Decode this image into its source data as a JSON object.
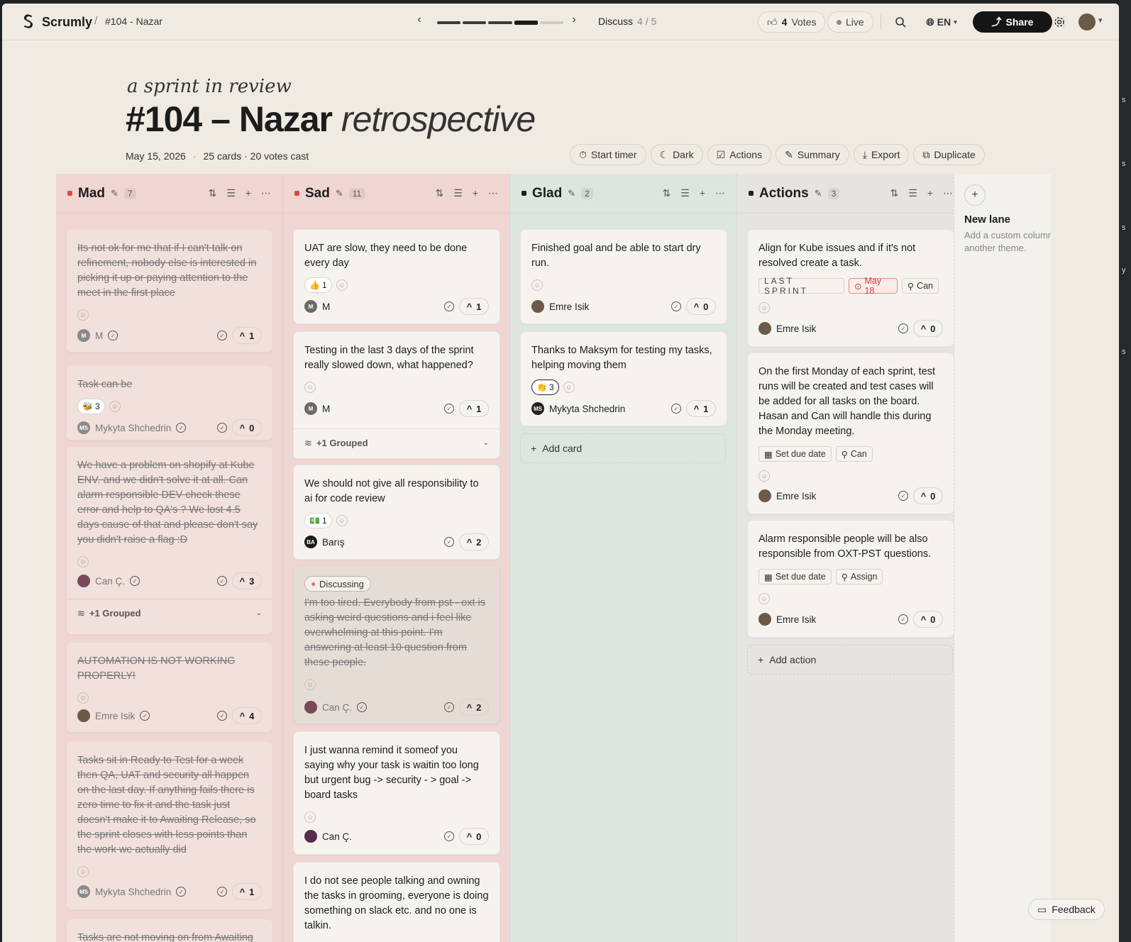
{
  "app": {
    "brand": "Scrumly",
    "crumb": "#104 - Nazar"
  },
  "stepper": {
    "phase": "Discuss",
    "count": "4 / 5"
  },
  "topbar": {
    "votes_num": "4",
    "votes_label": "Votes",
    "live": "Live",
    "lang": "EN",
    "share": "Share"
  },
  "hero": {
    "subtitle": "a sprint in review",
    "title_bold": "#104 – Nazar",
    "title_italic": "retrospective",
    "date": "May 15, 2026",
    "stats": "25 cards · 20 votes cast"
  },
  "toolbar": [
    "Start timer",
    "Dark",
    "Actions",
    "Summary",
    "Export",
    "Duplicate"
  ],
  "columns": {
    "mad": {
      "title": "Mad",
      "count": "7",
      "color": "#d64a43"
    },
    "sad": {
      "title": "Sad",
      "count": "11",
      "color": "#d64a43"
    },
    "glad": {
      "title": "Glad",
      "count": "2",
      "color": "#1e1e1e"
    },
    "actions": {
      "title": "Actions",
      "count": "3",
      "color": "#1e1e1e"
    }
  },
  "mad_cards": [
    {
      "text": "Its not ok for me that if I can't talk on refinement, nobody else is interested in picking it up or paying attention to the meet in the first place",
      "author": "M",
      "initials": "M",
      "votes": "1"
    },
    {
      "text": "Task can be",
      "emoji": "🐝",
      "emoji_count": "3",
      "author": "Mykyta Shchedrin",
      "initials": "MS",
      "votes": "0"
    },
    {
      "text": "We have a problem on shopify at Kube ENV. and we didn't solve it at all. Can alarm responsible DEV check these error and help to QA's ? We lost 4.5 days cause of that and please don't say you didn't raise a flag :D",
      "author": "Can Ç.",
      "initials": "",
      "votes": "3",
      "grouped": "+1 Grouped"
    },
    {
      "text": "AUTOMATION IS NOT WORKING PROPERLY!",
      "author": "Emre Isik",
      "initials": "",
      "votes": "4"
    },
    {
      "text": "Tasks sit in Ready to Test for a week then QA, UAT and security all happen on the last day. If anything fails there is zero time to fix it and the task just doesn't make it to Awaiting Release, so the sprint closes with less points than the work we actually did",
      "author": "Mykyta Shchedrin",
      "initials": "MS",
      "votes": "1"
    },
    {
      "text": "Tasks are not moving on from Awaiting"
    }
  ],
  "sad_cards": [
    {
      "text": "UAT are slow, they need to be done every day",
      "emoji": "👍",
      "emoji_count": "1",
      "author": "M",
      "initials": "M",
      "votes": "1"
    },
    {
      "text": "Testing in the last 3 days of the sprint really slowed down, what happened?",
      "author": "M",
      "initials": "M",
      "votes": "1",
      "grouped": "+1 Grouped"
    },
    {
      "text": "We should not give all responsibility to ai for code review",
      "emoji": "💵",
      "emoji_count": "1",
      "author": "Barış",
      "initials": "BA",
      "votes": "2"
    },
    {
      "badge": "Discussing",
      "text": "I'm too tired. Everybody from pst - oxt is asking weird questions and i feel like overwhelming at this point. I'm answering at least 10 question from these people.",
      "author": "Can Ç.",
      "initials": "",
      "votes": "2"
    },
    {
      "text": "I just wanna remind it someof you saying why your task is waitin too long but urgent bug -> security - > goal -> board tasks",
      "author": "Can Ç.",
      "initials": "",
      "votes": "0"
    },
    {
      "text": "I do not see people talking and owning the tasks in grooming, everyone is doing something on slack etc. and no one is talkin."
    }
  ],
  "glad_cards": [
    {
      "text": "Finished goal and be able to start dry run.",
      "author": "Emre Isik",
      "initials": "",
      "votes": "0"
    },
    {
      "text": "Thanks to Maksym for testing my tasks, helping moving them",
      "emoji": "👏",
      "emoji_count": "3",
      "author": "Mykyta Shchedrin",
      "initials": "MS",
      "votes": "1"
    }
  ],
  "glad_add": "Add card",
  "action_cards": [
    {
      "text": "Align for Kube issues and if it's not resolved create a task.",
      "tag_sprint": "LAST SPRINT",
      "tag_due": "May 18",
      "tag_assignee": "Can",
      "author": "Emre Isik",
      "votes": "0"
    },
    {
      "text": "On the first Monday of each sprint, test runs will be created and test cases will be added for all tasks on the board. Hasan and Can will handle this during the Monday meeting.",
      "tag_due": "Set due date",
      "tag_assignee": "Can",
      "author": "Emre Isik",
      "votes": "0"
    },
    {
      "text": "Alarm responsible people will be also responsible from OXT-PST questions.",
      "tag_due": "Set due date",
      "tag_assignee": "Assign",
      "author": "Emre Isik",
      "votes": "0"
    }
  ],
  "actions_add": "Add action",
  "newlane": {
    "title": "New lane",
    "desc": "Add a custom column for another theme."
  },
  "feedback": "Feedback",
  "edge_letters": [
    "s",
    "s",
    "s",
    "y",
    "s"
  ]
}
